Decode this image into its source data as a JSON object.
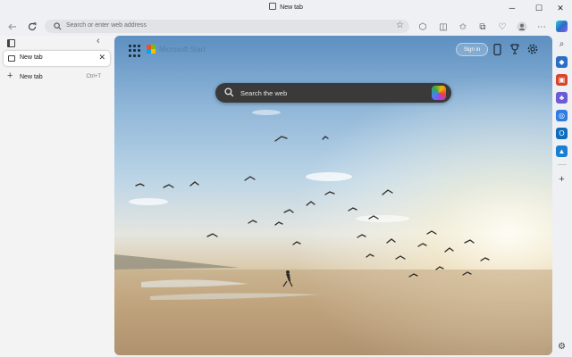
{
  "window": {
    "title": "New tab",
    "controls": {
      "minimize": "─",
      "maximize": "☐",
      "close": "✕"
    }
  },
  "toolbar": {
    "address_placeholder": "Search or enter web address"
  },
  "tab_pane": {
    "tabs": [
      {
        "label": "New tab",
        "active": true
      }
    ],
    "new_tab": {
      "label": "New tab",
      "shortcut": "Ctrl+T"
    }
  },
  "content": {
    "search_placeholder": "Search the web",
    "sign_in": "Sign in",
    "brand_text": "Microsoft Start"
  },
  "colors": {
    "ms_logo": [
      "#f25022",
      "#7fba00",
      "#00a4ef",
      "#ffb900"
    ],
    "sidebar_icons": [
      "#2b6cc4",
      "#d9432a",
      "#6b5bd6",
      "#2f7de1",
      "#0f6cbd",
      "#1a7fd1"
    ]
  },
  "sidebar": {
    "items": [
      {
        "name": "copilot-icon",
        "glyph": "C"
      },
      {
        "name": "search-icon",
        "glyph": "⌕"
      },
      {
        "name": "shopping-icon",
        "glyph": "◆"
      },
      {
        "name": "tools-icon",
        "glyph": "▣"
      },
      {
        "name": "games-icon",
        "glyph": "♣"
      },
      {
        "name": "m365-icon",
        "glyph": "◎"
      },
      {
        "name": "outlook-icon",
        "glyph": "O"
      },
      {
        "name": "drop-icon",
        "glyph": "▲"
      }
    ]
  }
}
